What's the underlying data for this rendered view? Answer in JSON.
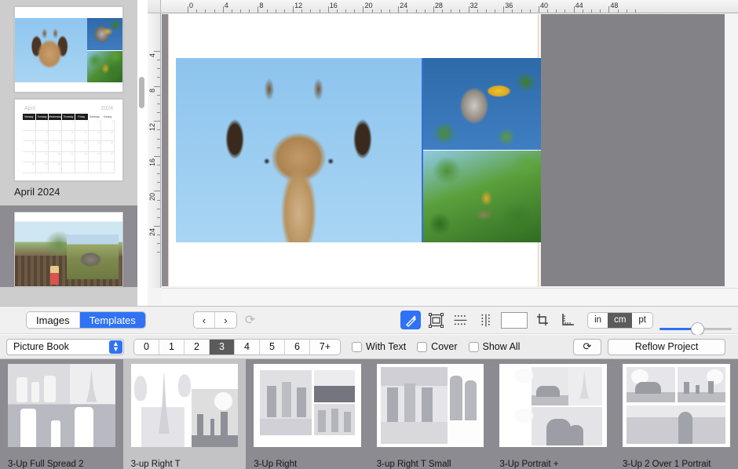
{
  "sidebar": {
    "pages": [
      {
        "label": "",
        "kind": "photo-spread",
        "selected": false
      },
      {
        "label": "April 2024",
        "kind": "calendar",
        "selected": false
      },
      {
        "label": "",
        "kind": "photo-spread-2",
        "selected": true
      }
    ],
    "calendar": {
      "month": "April",
      "year": "2024",
      "weekdays": [
        "Monday",
        "Tuesday",
        "Wednesday",
        "Thursday",
        "Friday",
        "Saturday",
        "Sunday"
      ]
    }
  },
  "rulers": {
    "unit": "cm",
    "horizontal_ticks": [
      "0",
      "4",
      "8",
      "12",
      "16",
      "20",
      "24",
      "28",
      "32",
      "36",
      "40",
      "44",
      "48"
    ],
    "vertical_ticks": [
      "4",
      "8",
      "12",
      "16",
      "20",
      "24"
    ]
  },
  "toolbar": {
    "source_tabs": [
      {
        "label": "Images",
        "active": false
      },
      {
        "label": "Templates",
        "active": true
      }
    ],
    "nav": {
      "prev": "‹",
      "next": "›",
      "refresh_icon": "refresh-icon"
    },
    "tools": [
      {
        "name": "magic-wand-icon",
        "active": true
      },
      {
        "name": "frame-select-icon",
        "active": false
      },
      {
        "name": "horizontal-distribute-icon",
        "active": false
      },
      {
        "name": "vertical-distribute-icon",
        "active": false
      }
    ],
    "color_swatch": "#ffffff",
    "crop_icon": "crop-icon",
    "ruler_icon": "ruler-icon",
    "units": [
      {
        "label": "in",
        "active": false
      },
      {
        "label": "cm",
        "active": true
      },
      {
        "label": "pt",
        "active": false
      }
    ],
    "zoom_label": "Zoom"
  },
  "filterbar": {
    "category": "Picture Book",
    "counts": [
      {
        "label": "0",
        "active": false
      },
      {
        "label": "1",
        "active": false
      },
      {
        "label": "2",
        "active": false
      },
      {
        "label": "3",
        "active": true
      },
      {
        "label": "4",
        "active": false
      },
      {
        "label": "5",
        "active": false
      },
      {
        "label": "6",
        "active": false
      },
      {
        "label": "7+",
        "active": false
      }
    ],
    "checkboxes": [
      {
        "label": "With Text",
        "checked": false
      },
      {
        "label": "Cover",
        "checked": false
      },
      {
        "label": "Show All",
        "checked": false
      }
    ],
    "refresh_icon": "refresh-icon",
    "reflow_label": "Reflow Project"
  },
  "templates": [
    {
      "label": "3-Up Full Spread 2",
      "state": "selected"
    },
    {
      "label": "3-up Right T",
      "state": "highlight"
    },
    {
      "label": "3-Up Right",
      "state": "normal"
    },
    {
      "label": "3-up Right T Small",
      "state": "normal"
    },
    {
      "label": "3-Up Portrait +",
      "state": "normal"
    },
    {
      "label": "3-Up 2 Over 1 Portrait",
      "state": "normal"
    }
  ],
  "colors": {
    "accent": "#2f72f5",
    "canvas_gray": "#828287",
    "strip_gray": "#8b8b91",
    "sidebar_gray": "#cdcdcd"
  }
}
